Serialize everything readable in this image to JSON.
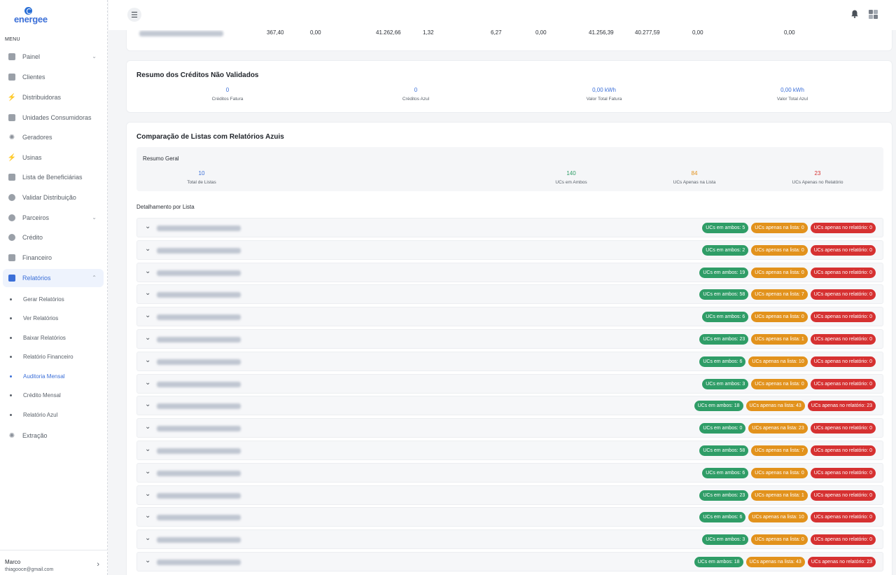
{
  "brand": {
    "name": "energee",
    "color": "#3b6fd8"
  },
  "sidebar": {
    "menu_label": "MENU",
    "items": [
      {
        "label": "Painel",
        "icon": "dashboard-icon",
        "chevron": "⌄"
      },
      {
        "label": "Clientes",
        "icon": "users-icon"
      },
      {
        "label": "Distribuidoras",
        "icon": "bolt-icon"
      },
      {
        "label": "Unidades Consumidoras",
        "icon": "building-icon"
      },
      {
        "label": "Geradores",
        "icon": "sun-icon"
      },
      {
        "label": "Usinas",
        "icon": "plant-icon"
      },
      {
        "label": "Lista de Beneficiárias",
        "icon": "list-icon"
      },
      {
        "label": "Validar Distribuição",
        "icon": "check-circle-icon"
      },
      {
        "label": "Parceiros",
        "icon": "partners-icon",
        "chevron": "⌄"
      },
      {
        "label": "Crédito",
        "icon": "coin-icon"
      },
      {
        "label": "Financeiro",
        "icon": "wallet-icon"
      },
      {
        "label": "Relatórios",
        "icon": "report-icon",
        "chevron": "⌃"
      }
    ],
    "sub_items": [
      {
        "label": "Gerar Relatórios"
      },
      {
        "label": "Ver Relatórios"
      },
      {
        "label": "Baixar Relatórios"
      },
      {
        "label": "Relatório Financeiro"
      },
      {
        "label": "Auditoria Mensal"
      },
      {
        "label": "Crédito Mensal"
      },
      {
        "label": "Relatório Azul"
      }
    ],
    "extra_item": {
      "label": "Extração",
      "icon": "sun-icon"
    },
    "user": {
      "name": "Marco",
      "email": "thiagooce@gmail.com"
    }
  },
  "top_row": [
    "367,40",
    "0,00",
    "41.262,66",
    "1,32",
    "6,27",
    "0,00",
    "41.256,39",
    "40.277,59",
    "0,00",
    "0,00"
  ],
  "nao_validados": {
    "title": "Resumo dos Créditos Não Validados",
    "stats": [
      {
        "value": "0",
        "label": "Créditos Fatura"
      },
      {
        "value": "0",
        "label": "Créditos Azul"
      },
      {
        "value": "0,00 kWh",
        "label": "Valor Total Fatura"
      },
      {
        "value": "0,00 kWh",
        "label": "Valor Total Azul"
      }
    ]
  },
  "comparacao": {
    "title": "Comparação de Listas com Relatórios Azuis",
    "summary_title": "Resumo Geral",
    "summary": [
      {
        "value": "10",
        "label": "Total de Listas",
        "color": "#3b6fd8"
      },
      {
        "value": "140",
        "label": "UCs em Ambos",
        "color": "#2f9d67"
      },
      {
        "value": "84",
        "label": "UCs Apenas na Lista",
        "color": "#e2921c"
      },
      {
        "value": "23",
        "label": "UCs Apenas no Relatório",
        "color": "#d63131"
      }
    ],
    "detail_title": "Detalhamento por Lista",
    "rows": [
      {
        "ambos": "UCs em ambos: 5",
        "lista": "UCs apenas na lista: 0",
        "relatorio": "UCs apenas no relatório: 0"
      },
      {
        "ambos": "UCs em ambos: 2",
        "lista": "UCs apenas na lista: 0",
        "relatorio": "UCs apenas no relatório: 0"
      },
      {
        "ambos": "UCs em ambos: 19",
        "lista": "UCs apenas na lista: 0",
        "relatorio": "UCs apenas no relatório: 0"
      },
      {
        "ambos": "UCs em ambos: 58",
        "lista": "UCs apenas na lista: 7",
        "relatorio": "UCs apenas no relatório: 0"
      },
      {
        "ambos": "UCs em ambos: 6",
        "lista": "UCs apenas na lista: 0",
        "relatorio": "UCs apenas no relatório: 0"
      },
      {
        "ambos": "UCs em ambos: 23",
        "lista": "UCs apenas na lista: 1",
        "relatorio": "UCs apenas no relatório: 0"
      },
      {
        "ambos": "UCs em ambos: 6",
        "lista": "UCs apenas na lista: 10",
        "relatorio": "UCs apenas no relatório: 0"
      },
      {
        "ambos": "UCs em ambos: 3",
        "lista": "UCs apenas na lista: 0",
        "relatorio": "UCs apenas no relatório: 0"
      },
      {
        "ambos": "UCs em ambos: 18",
        "lista": "UCs apenas na lista: 43",
        "relatorio": "UCs apenas no relatório: 23"
      },
      {
        "ambos": "UCs em ambos: 0",
        "lista": "UCs apenas na lista: 23",
        "relatorio": "UCs apenas no relatório: 0"
      },
      {
        "ambos": "UCs em ambos: 58",
        "lista": "UCs apenas na lista: 7",
        "relatorio": "UCs apenas no relatório: 0"
      },
      {
        "ambos": "UCs em ambos: 6",
        "lista": "UCs apenas na lista: 0",
        "relatorio": "UCs apenas no relatório: 0"
      },
      {
        "ambos": "UCs em ambos: 23",
        "lista": "UCs apenas na lista: 1",
        "relatorio": "UCs apenas no relatório: 0"
      },
      {
        "ambos": "UCs em ambos: 6",
        "lista": "UCs apenas na lista: 10",
        "relatorio": "UCs apenas no relatório: 0"
      },
      {
        "ambos": "UCs em ambos: 3",
        "lista": "UCs apenas na lista: 0",
        "relatorio": "UCs apenas no relatório: 0"
      },
      {
        "ambos": "UCs em ambos: 18",
        "lista": "UCs apenas na lista: 43",
        "relatorio": "UCs apenas no relatório: 23"
      }
    ]
  }
}
